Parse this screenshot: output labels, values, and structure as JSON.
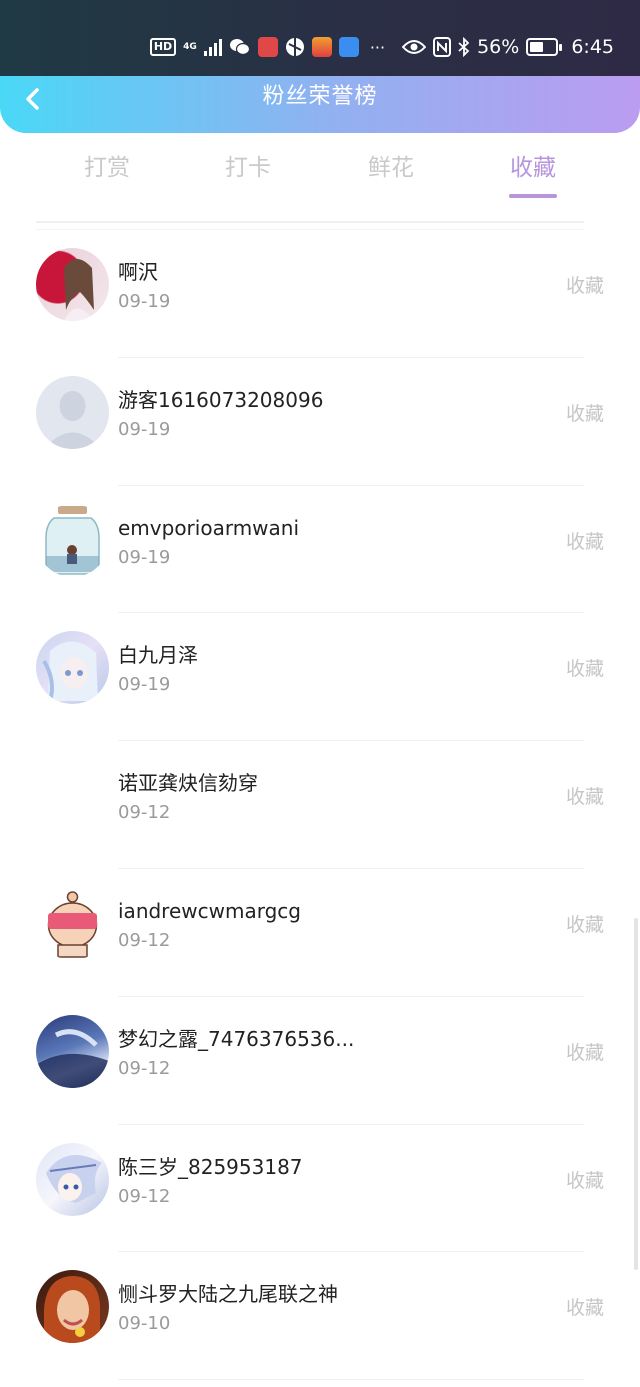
{
  "status_bar": {
    "hd_label": "HD",
    "network_label": "4G",
    "battery_percent_text": "56%",
    "battery_level": 0.56,
    "time": "6:45",
    "more_label": "···"
  },
  "header": {
    "title": "粉丝荣誉榜"
  },
  "tabs": [
    {
      "label": "打赏",
      "active": false
    },
    {
      "label": "打卡",
      "active": false
    },
    {
      "label": "鲜花",
      "active": false
    },
    {
      "label": "收藏",
      "active": true
    }
  ],
  "fans": [
    {
      "name": "啊沢",
      "date": "09-19",
      "action": "收藏",
      "avatar": "avatar-woman-photo"
    },
    {
      "name": "游客1616073208096",
      "date": "09-19",
      "action": "收藏",
      "avatar": "avatar-default-silhouette"
    },
    {
      "name": "emvporioarmwani",
      "date": "09-19",
      "action": "收藏",
      "avatar": "avatar-jar-illustration"
    },
    {
      "name": "白九月泽",
      "date": "09-19",
      "action": "收藏",
      "avatar": "avatar-anime-girl"
    },
    {
      "name": "诺亚龚炔信劾穿",
      "date": "09-12",
      "action": "收藏",
      "avatar": "avatar-empty"
    },
    {
      "name": "iandrewcwmargcg",
      "date": "09-12",
      "action": "收藏",
      "avatar": "avatar-pixel-character"
    },
    {
      "name": "梦幻之露_7476376536...",
      "date": "09-12",
      "action": "收藏",
      "avatar": "avatar-blue-painting"
    },
    {
      "name": "陈三岁_825953187",
      "date": "09-12",
      "action": "收藏",
      "avatar": "avatar-anime-boy"
    },
    {
      "name": "恻斗罗大陆之九尾联之神",
      "date": "09-10",
      "action": "收藏",
      "avatar": "avatar-redhair-photo"
    }
  ],
  "colors": {
    "accent": "#b795dc",
    "header_gradient_start": "#4ad8f7",
    "header_gradient_end": "#bb9cf0",
    "inactive_tab": "#c9c9c9",
    "date_text": "#9a9a9a"
  }
}
